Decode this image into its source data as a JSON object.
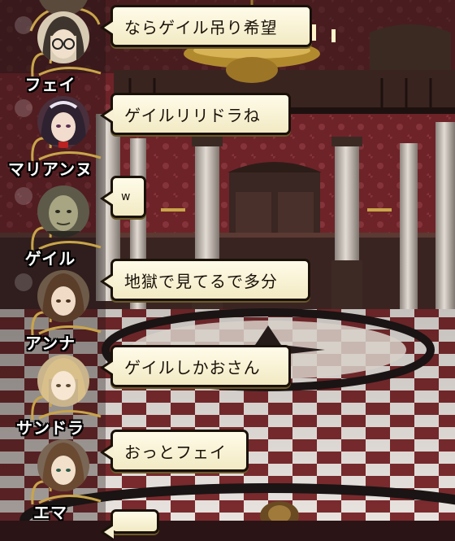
{
  "messages": [
    {
      "speaker": "",
      "text": "ならゲイル吊り希望"
    },
    {
      "speaker": "フェイ",
      "text": "ゲイルリリドラね"
    },
    {
      "speaker": "マリアンヌ",
      "text": "w"
    },
    {
      "speaker": "ゲイル",
      "text": "地獄で見てるで多分"
    },
    {
      "speaker": "アンナ",
      "text": "ゲイルしかおさん"
    },
    {
      "speaker": "サンドラ",
      "text": "おっとフェイ"
    },
    {
      "speaker": "エマ",
      "text": ""
    }
  ],
  "colors": {
    "bubble_fill": "#f7f0d2",
    "bubble_border": "#1a1108",
    "wall_red": "#7a2a30",
    "pillar": "#cfc6bc",
    "floor_red": "#7b2b2e",
    "floor_light": "#e9e4df"
  }
}
